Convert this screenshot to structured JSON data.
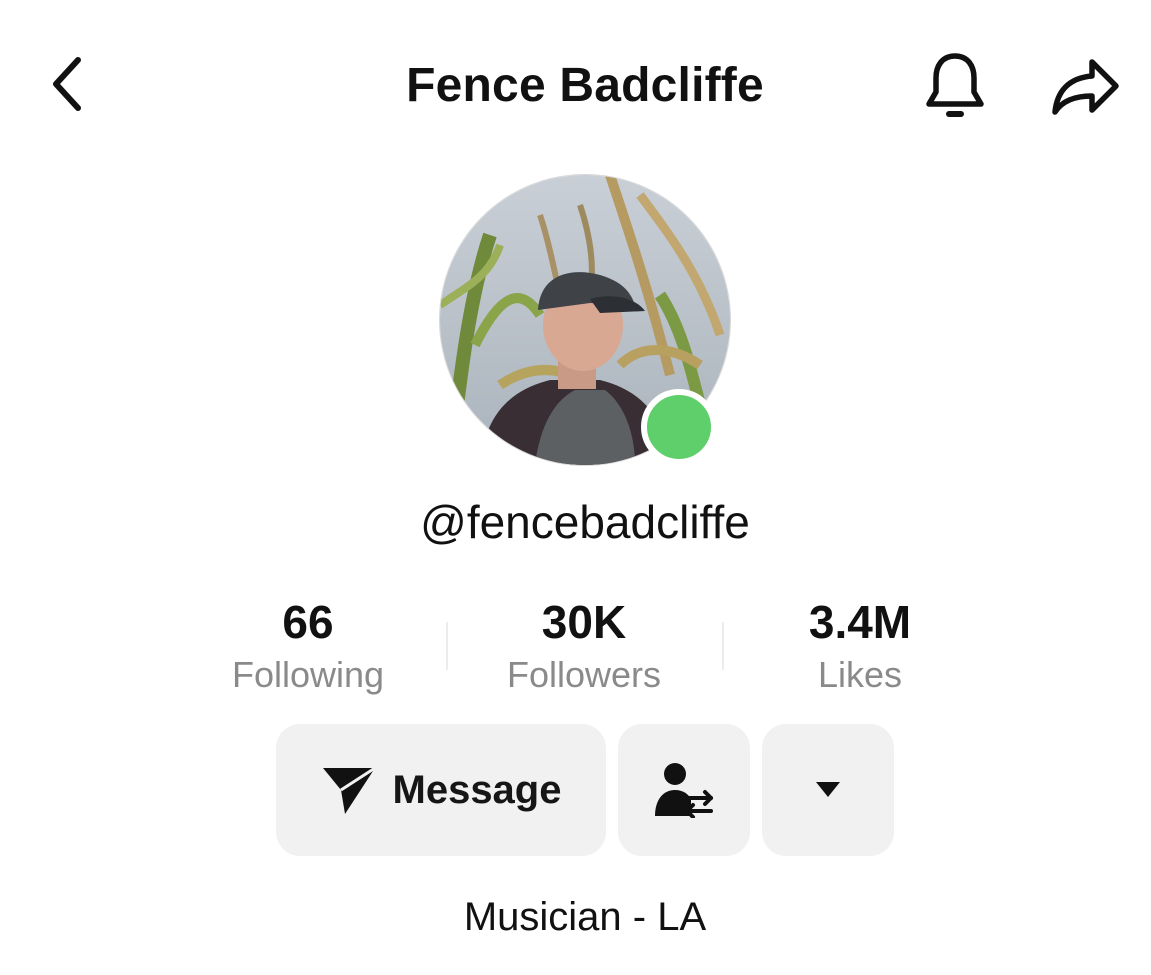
{
  "header": {
    "title": "Fence Badcliffe",
    "back_icon": "chevron-left-icon",
    "bell_icon": "bell-icon",
    "share_icon": "share-arrow-icon"
  },
  "profile": {
    "handle": "@fencebadcliffe",
    "online_color": "#5fcf6c",
    "bio": "Musician - LA"
  },
  "stats": [
    {
      "value": "66",
      "label": "Following"
    },
    {
      "value": "30K",
      "label": "Followers"
    },
    {
      "value": "3.4M",
      "label": "Likes"
    }
  ],
  "actions": {
    "message_label": "Message",
    "message_icon": "paper-plane-icon",
    "friend_icon": "person-swap-icon",
    "more_icon": "caret-down-icon"
  }
}
